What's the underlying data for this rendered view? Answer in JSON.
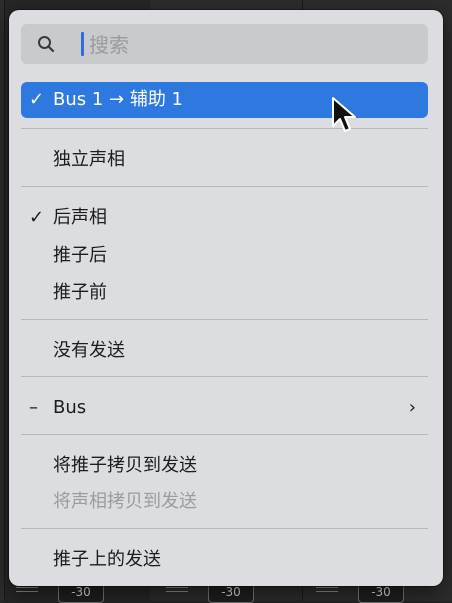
{
  "search": {
    "placeholder": "搜索",
    "value": ""
  },
  "menu": {
    "selected_route": {
      "check": "✓",
      "label": "Bus 1 → 辅助 1"
    },
    "solo_pan": "独立声相",
    "post_pan": {
      "check": "✓",
      "label": "后声相"
    },
    "post_fader": "推子后",
    "pre_fader": "推子前",
    "no_send": "没有发送",
    "bus": {
      "mark": "–",
      "label": "Bus",
      "arrow": "›"
    },
    "copy_fader": "将推子拷贝到发送",
    "copy_pan": "将声相拷贝到发送",
    "sends_on_fader": "推子上的发送"
  },
  "background": {
    "fader_values": [
      "-30",
      "-30",
      "-30"
    ]
  },
  "colors": {
    "accent": "#2d79e0",
    "menu_bg": "#dcdde0",
    "disabled": "#9b9c9f"
  }
}
